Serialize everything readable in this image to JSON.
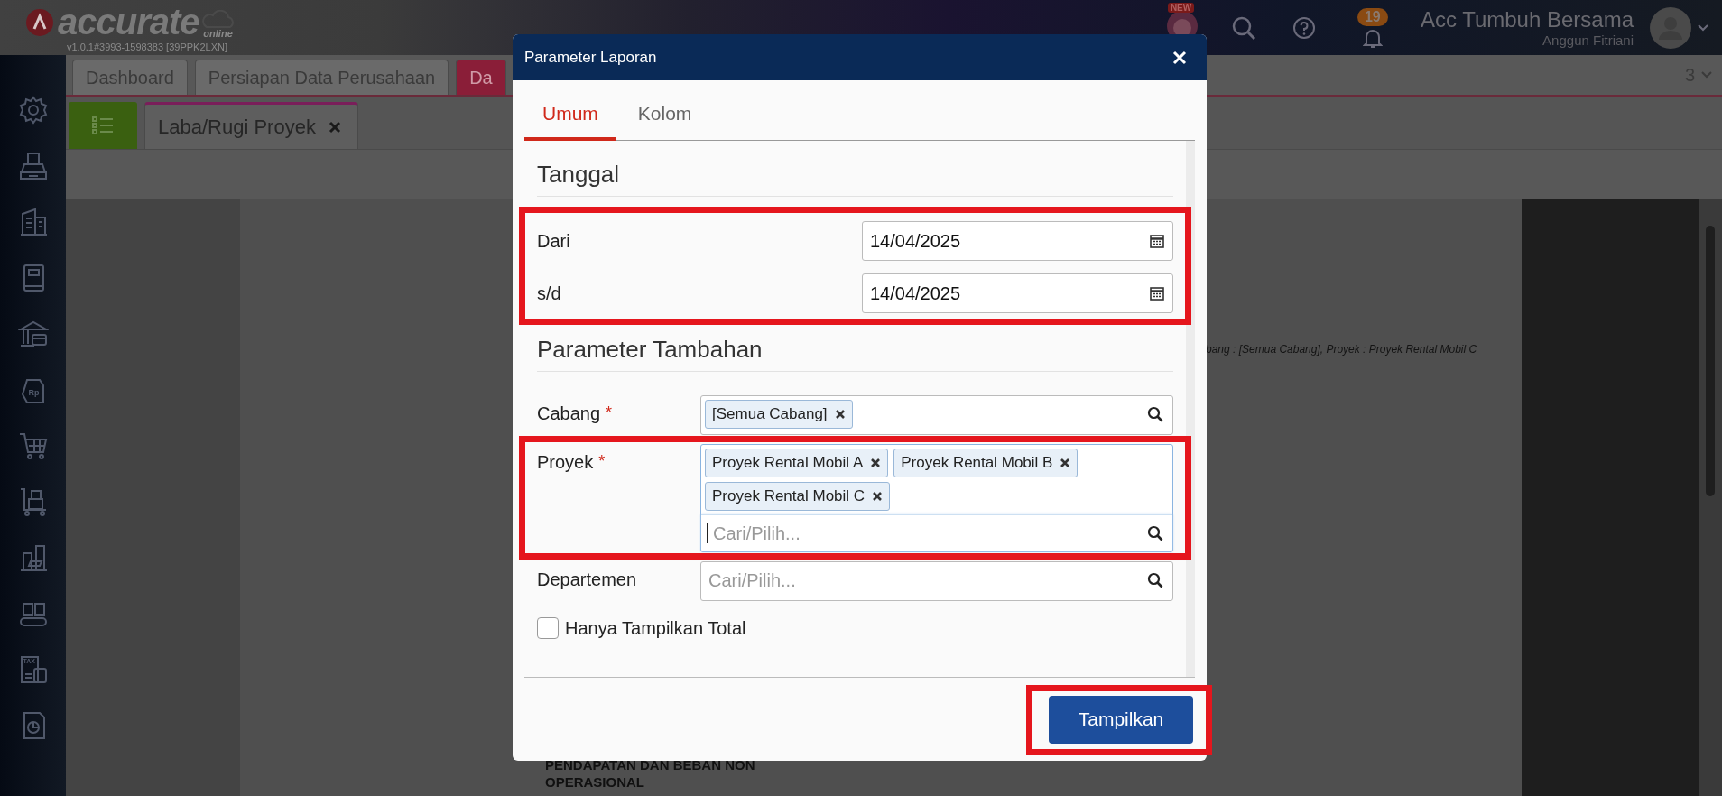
{
  "app": {
    "logo_text": "accurate",
    "logo_subtext": "online",
    "version": "v1.0.1#3993-1598383 [39PPK2LXN]"
  },
  "header": {
    "new_badge": "NEW",
    "notification_count": "19",
    "company": "Acc Tumbuh Bersama",
    "user": "Anggun Fitriani"
  },
  "sidebar": {
    "items": [
      {
        "kind": "gear"
      },
      {
        "kind": "register"
      },
      {
        "kind": "building"
      },
      {
        "kind": "book"
      },
      {
        "kind": "bank"
      },
      {
        "kind": "tag",
        "icon_text": "Rp"
      },
      {
        "kind": "cart"
      },
      {
        "kind": "trolley"
      },
      {
        "kind": "city"
      },
      {
        "kind": "conveyor"
      },
      {
        "kind": "tax",
        "icon_text": "TAX"
      },
      {
        "kind": "report"
      }
    ]
  },
  "tabs": [
    {
      "label": "Dashboard",
      "selected": false
    },
    {
      "label": "Persiapan Data Perusahaan",
      "selected": false
    },
    {
      "label": "Da",
      "selected": true
    }
  ],
  "tab_count": "3",
  "subtabs": [
    {
      "label": "Laba/Rugi Proyek",
      "selected": true
    }
  ],
  "report": {
    "filter_line": "bang : [Semua Cabang], Proyek : Proyek Rental Mobil C",
    "section_heading": "PENDAPATAN DAN BEBAN NON OPERASIONAL"
  },
  "dialog": {
    "title": "Parameter Laporan",
    "tabs": [
      {
        "label": "Umum",
        "selected": true
      },
      {
        "label": "Kolom",
        "selected": false
      }
    ],
    "sections": [
      {
        "title": "Tanggal",
        "highlighted": true,
        "fields": [
          {
            "kind": "date",
            "label": "Dari",
            "value": "14/04/2025"
          },
          {
            "kind": "date",
            "label": "s/d",
            "value": "14/04/2025"
          }
        ]
      },
      {
        "title": "Parameter Tambahan",
        "highlighted": false,
        "fields": [
          {
            "kind": "multiselect",
            "label": "Cabang",
            "required_mark": "*",
            "tags": [
              "[Semua Cabang]"
            ],
            "focused": false,
            "highlighted": false
          },
          {
            "kind": "multiselect",
            "label": "Proyek",
            "required_mark": "*",
            "tags": [
              "Proyek Rental Mobil A",
              "Proyek Rental Mobil B",
              "Proyek Rental Mobil C"
            ],
            "placeholder": "Cari/Pilih...",
            "focused": true,
            "highlighted": true
          },
          {
            "kind": "multiselect",
            "label": "Departemen",
            "placeholder": "Cari/Pilih...",
            "focused": false,
            "highlighted": false
          },
          {
            "kind": "checkbox",
            "label": "Hanya Tampilkan Total",
            "checked": false
          }
        ]
      }
    ],
    "submit": {
      "label": "Tampilkan",
      "highlighted": true
    }
  }
}
